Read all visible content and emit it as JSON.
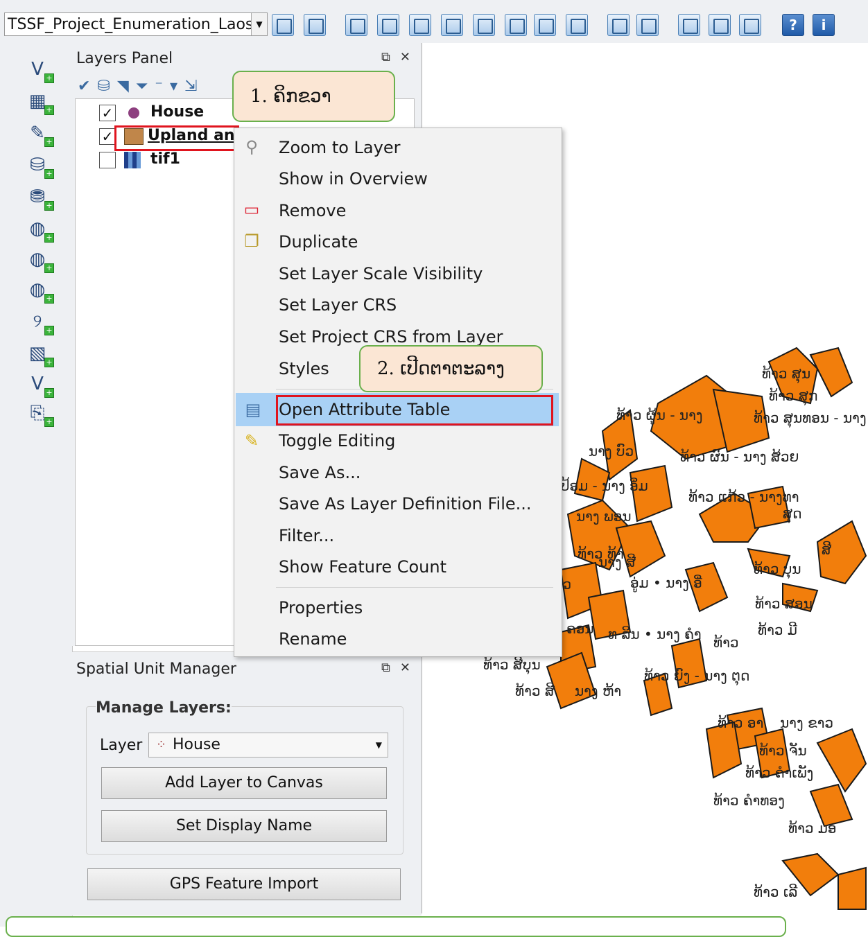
{
  "toolbar": {
    "project_combo": "TSSF_Project_Enumeration_Laos"
  },
  "layers_panel": {
    "title": "Layers Panel",
    "layers": [
      {
        "name": "House",
        "checked": true
      },
      {
        "name": "Upland an",
        "checked": true
      },
      {
        "name": "tif1",
        "checked": false
      }
    ]
  },
  "context_menu": {
    "items": [
      "Zoom to Layer",
      "Show in Overview",
      "Remove",
      "Duplicate",
      "Set Layer Scale Visibility",
      "Set Layer CRS",
      "Set Project CRS from Layer",
      "Styles",
      "Open Attribute Table",
      "Toggle Editing",
      "Save As...",
      "Save As Layer Definition File...",
      "Filter...",
      "Show Feature Count",
      "Properties",
      "Rename"
    ],
    "highlighted": "Open Attribute Table"
  },
  "callouts": {
    "step1": "1. ຄິກຂວາ",
    "step2": "2. ເປີດຕາຕະລາງ"
  },
  "spatial_unit_manager": {
    "title": "Spatial Unit Manager",
    "group_label": "Manage Layers:",
    "layer_label": "Layer",
    "layer_value": "House",
    "add_button": "Add Layer to Canvas",
    "display_button": "Set Display Name",
    "gps_button": "GPS Feature Import"
  },
  "map_labels": [
    "ທ້າວ ສຸນ",
    "ທ້າວ ສຸກ",
    "ທ້າວ ຜູ້ນ - ນາງ",
    "ທ້າວ ສຸນທອນ - ນາງ",
    "ນາງ ບົວ",
    "ທ້າວ ຜົນ - ນາງ ສ້ວຍ",
    "ປ້ອມ - ນາງ ອິ່ມ",
    "ທ້າວ ແກ້ວ - ນາງທາ",
    "ສຸດ",
    "ນາງ ພອນ",
    "ສີ",
    "ທ້າວ ທ້າ",
    "ນາງ ສີ",
    "ອູ່ມ • ນາງ ອີ່",
    "ທ້າວ ບຸນ",
    "ທ້າວ ສອນ",
    "ບົວ",
    "ຄອນ",
    "ທ ລິນ • ນາງ ຄຳ",
    "ທ້າວ",
    "ທ້າວ ມີ",
    "ທ້າວ ສີບຸນ",
    "ທ້າວ ຍົງ - ນາງ ຕຸດ",
    "ທ້າວ ສີ",
    "ນາງ ຫ້າ",
    "ທ້າວ ອາ",
    "ນາງ ຂາວ",
    "ທ້າວ ຈັນ",
    "ທ້າວ ຄຳເພັງ",
    "ທ້າວ ຄຳທອງ",
    "ທ້າວ ມອ",
    "ທ້າວ ເລີ"
  ]
}
